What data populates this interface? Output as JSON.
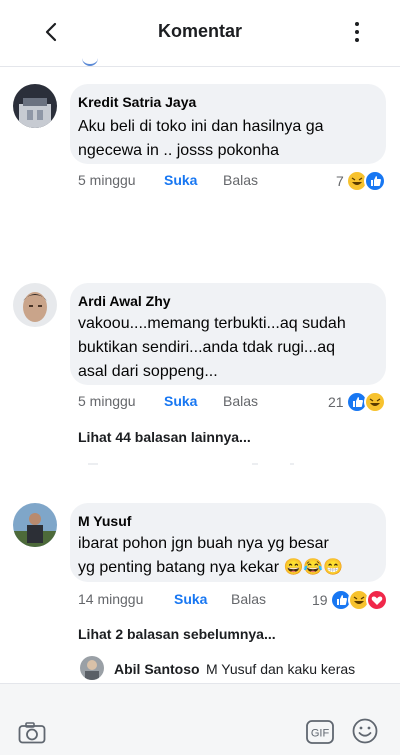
{
  "header": {
    "title": "Komentar",
    "back_icon": "chevron-left-icon",
    "menu_icon": "more-vertical-icon"
  },
  "comments": [
    {
      "name": "Kredit Satria Jaya",
      "text": "Aku beli di toko ini dan hasilnya ga\nngecewa in .. josss pokonha",
      "time": "5 minggu",
      "like_label": "Suka",
      "reply_label": "Balas",
      "reaction_count": "7",
      "reactions": [
        "haha",
        "like"
      ]
    },
    {
      "name": "Ardi Awal Zhy",
      "text": "vakoou....memang terbukti...aq sudah\nbuktikan sendiri...anda tdak rugi...aq\nasal dari soppeng...",
      "time": "5 minggu",
      "like_label": "Suka",
      "reply_label": "Balas",
      "reaction_count": "21",
      "reactions": [
        "like",
        "haha"
      ],
      "more_replies": "Lihat 44 balasan lainnya..."
    },
    {
      "name": "M Yusuf",
      "text": "ibarat pohon jgn buah nya yg besar\nyg penting batang nya kekar 😄😂😁",
      "time": "14 minggu",
      "like_label": "Suka",
      "reply_label": "Balas",
      "reaction_count": "19",
      "reactions": [
        "like",
        "haha",
        "love"
      ],
      "more_replies": "Lihat 2 balasan sebelumnya..."
    }
  ],
  "reply_preview": {
    "name": "Abil Santoso",
    "text": "M Yusuf dan kaku keras"
  },
  "footer": {
    "camera_icon": "camera-icon",
    "gif_label": "GIF",
    "emoji_icon": "smiley-icon"
  },
  "colors": {
    "link_blue": "#1877f2",
    "bubble": "#f0f2f5",
    "meta_gray": "#65676b"
  }
}
